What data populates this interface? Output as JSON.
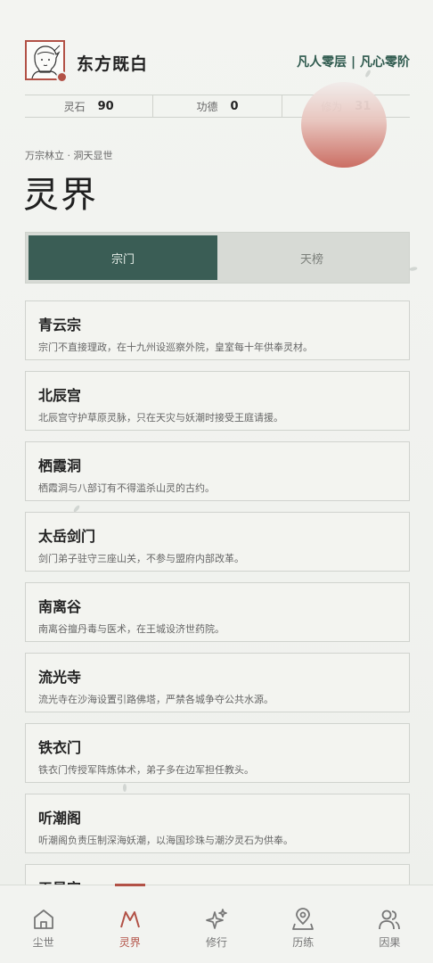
{
  "user": {
    "name": "东方既白",
    "realm": "凡人零层 | 凡心零阶",
    "avatar_icon": "character-portrait-icon"
  },
  "stats": [
    {
      "label": "灵石",
      "value": "90"
    },
    {
      "label": "功德",
      "value": "0"
    },
    {
      "label": "修为",
      "value": "31"
    }
  ],
  "breadcrumb": "万宗林立 · 洞天显世",
  "page_title": "灵界",
  "tabs": [
    {
      "label": "宗门",
      "active": true
    },
    {
      "label": "天榜",
      "active": false
    }
  ],
  "sects": [
    {
      "name": "青云宗",
      "desc": "宗门不直接理政，在十九州设巡察外院，皇室每十年供奉灵材。"
    },
    {
      "name": "北辰宫",
      "desc": "北辰宫守护草原灵脉，只在天灾与妖潮时接受王庭请援。"
    },
    {
      "name": "栖霞洞",
      "desc": "栖霞洞与八部订有不得滥杀山灵的古约。"
    },
    {
      "name": "太岳剑门",
      "desc": "剑门弟子驻守三座山关，不参与盟府内部改革。"
    },
    {
      "name": "南离谷",
      "desc": "南离谷擅丹毒与医术，在王城设济世药院。"
    },
    {
      "name": "流光寺",
      "desc": "流光寺在沙海设置引路佛塔，严禁各城争夺公共水源。"
    },
    {
      "name": "铁衣门",
      "desc": "铁衣门传授军阵炼体术，弟子多在边军担任教头。"
    },
    {
      "name": "听潮阁",
      "desc": "听潮阁负责压制深海妖潮，以海国珍珠与潮汐灵石为供奉。"
    },
    {
      "name": "天星宫",
      "desc": ""
    }
  ],
  "nav": [
    {
      "label": "尘世",
      "icon": "home-icon",
      "active": false
    },
    {
      "label": "灵界",
      "icon": "mountain-icon",
      "active": true
    },
    {
      "label": "修行",
      "icon": "sparkle-icon",
      "active": false
    },
    {
      "label": "历练",
      "icon": "map-pin-icon",
      "active": false
    },
    {
      "label": "因果",
      "icon": "users-icon",
      "active": false
    }
  ],
  "colors": {
    "accent": "#b25146",
    "primary": "#3a5d55",
    "background": "#f1f2ee"
  }
}
